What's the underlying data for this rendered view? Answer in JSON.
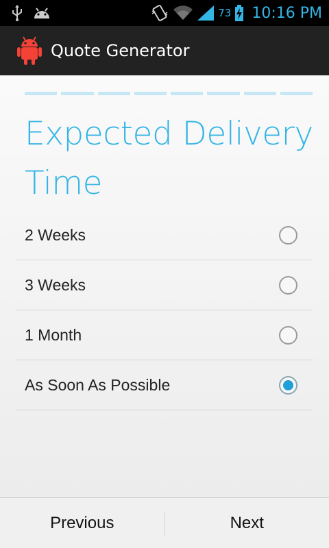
{
  "status_bar": {
    "time": "10:16 PM",
    "battery_level": "73",
    "icons": [
      "usb-icon",
      "android-debug-icon",
      "vibrate-icon",
      "wifi-icon",
      "signal-icon",
      "battery-charging-icon"
    ]
  },
  "action_bar": {
    "title": "Quote Generator",
    "icon": "android-robot-icon"
  },
  "wizard": {
    "progress_steps": 8,
    "title": "Expected Delivery Time",
    "options": [
      {
        "label": "2 Weeks",
        "selected": false
      },
      {
        "label": "3 Weeks",
        "selected": false
      },
      {
        "label": "1 Month",
        "selected": false
      },
      {
        "label": "As Soon As Possible",
        "selected": true
      }
    ]
  },
  "navigation": {
    "previous_label": "Previous",
    "next_label": "Next"
  },
  "colors": {
    "accent": "#33b5e5",
    "progress": "#c6e7f5",
    "radio_selected": "#1f9fd8"
  }
}
